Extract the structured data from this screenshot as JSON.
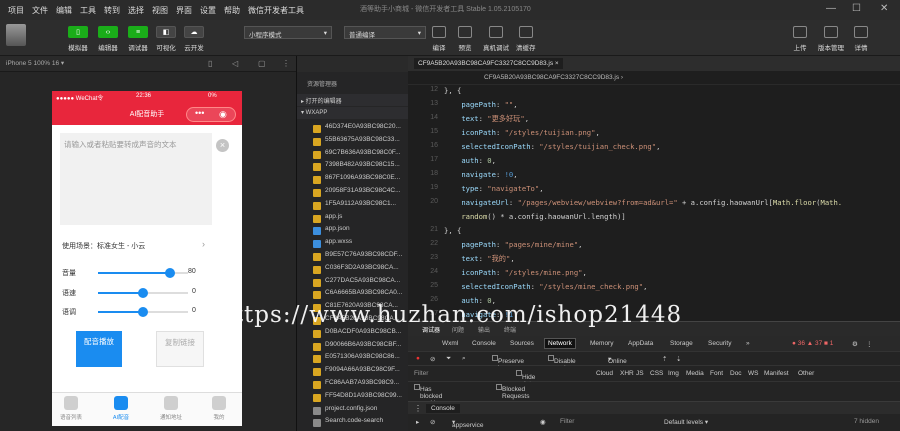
{
  "menubar": {
    "items": [
      "项目",
      "文件",
      "编辑",
      "工具",
      "转到",
      "选择",
      "视图",
      "界面",
      "设置",
      "帮助",
      "微信开发者工具"
    ],
    "title": "酒等助手小商城 - 微信开发者工具 Stable 1.05.2105170"
  },
  "toolbar": {
    "buttons": [
      {
        "icon": "code-icon",
        "label": "模拟器"
      },
      {
        "icon": "code-icon",
        "label": "编辑器"
      },
      {
        "icon": "debug-icon",
        "label": "调试器"
      },
      {
        "icon": "visual-icon",
        "label": "可视化"
      },
      {
        "icon": "cloud-icon",
        "label": "云开发"
      }
    ],
    "mode_select": "小程序模式",
    "compile_select": "普通编译",
    "actions": [
      "编译",
      "预览",
      "真机调试",
      "清缓存"
    ],
    "right": [
      "上传",
      "版本管理",
      "详情"
    ]
  },
  "simulator": {
    "device": "iPhone 5 100% 16 ▾",
    "status": {
      "carrier": "●●●●● WeChat令",
      "time": "22:36",
      "battery": "0%"
    },
    "nav_title": "AI配音助手",
    "placeholder": "请输入或者粘贴要转成声音的文本",
    "scene": "使用场景：标准女生 - 小云",
    "sliders": [
      {
        "label": "音量",
        "value": "80",
        "level": 0.8
      },
      {
        "label": "语速",
        "value": "0",
        "level": 0.5
      },
      {
        "label": "语调",
        "value": "0",
        "level": 0.5
      }
    ],
    "btn_compose": "配音播放",
    "btn_copy": "复制链接",
    "tabs": [
      "语音列表",
      "AI配音",
      "通知地址",
      "我的"
    ]
  },
  "explorer": {
    "title": "资源管理器",
    "section_open": "▸ 打开的编辑器",
    "section_app": "▾ WXAPP",
    "files": [
      {
        "name": "46D374E0A93BC98C20...",
        "t": "y"
      },
      {
        "name": "55B63675A93BC98C33...",
        "t": "y"
      },
      {
        "name": "69C7B636A93BC98C0F...",
        "t": "y"
      },
      {
        "name": "7398B482A93BC98C15...",
        "t": "y"
      },
      {
        "name": "867F1096A93BC98C0E...",
        "t": "y"
      },
      {
        "name": "20958F31A93BC98C4C...",
        "t": "y"
      },
      {
        "name": "1F5A9112A93BC98C1...",
        "t": "y"
      },
      {
        "name": "app.js",
        "t": "y"
      },
      {
        "name": "app.json",
        "t": "b"
      },
      {
        "name": "app.wxss",
        "t": "b"
      },
      {
        "name": "B9E57C76A93BC98CDF...",
        "t": "y"
      },
      {
        "name": "C036F3D2A93BC98CA...",
        "t": "y"
      },
      {
        "name": "C277DAC5A93BC98CA...",
        "t": "y"
      },
      {
        "name": "C6A6665BA93BC98CA0...",
        "t": "y"
      },
      {
        "name": "C81E7620A93BC98CA...",
        "t": "y"
      },
      {
        "name": "CF9A5B20A93BC98CA...",
        "t": "y"
      },
      {
        "name": "D0BACDF0A93BC98CB...",
        "t": "y"
      },
      {
        "name": "D90066B6A93BC98CBF...",
        "t": "y"
      },
      {
        "name": "E0571306A93BC98C86...",
        "t": "y"
      },
      {
        "name": "F9094A66A93BC98C9F...",
        "t": "y"
      },
      {
        "name": "FC86AAB7A93BC98C9...",
        "t": "y"
      },
      {
        "name": "FF54D8D1A93BC98C99...",
        "t": "y"
      },
      {
        "name": "project.config.json",
        "t": "g"
      },
      {
        "name": "Search.code-search",
        "t": "g"
      }
    ]
  },
  "editor": {
    "tab": "CF9A5B20A93BC98CA9FC3327C8CC9D83.js ×",
    "crumb": "CF9A5B20A93BC98CA9FC3327C8CC9D83.js ›",
    "line_numbers": [
      "12",
      "13",
      "14",
      "15",
      "16",
      "17",
      "18",
      "19",
      "20",
      "",
      "21",
      "22",
      "23",
      "24",
      "25",
      "26",
      "27"
    ]
  },
  "devtools": {
    "top_tabs": [
      "调试器",
      "问题",
      "输出",
      "终端"
    ],
    "tabs": [
      "Wxml",
      "Console",
      "Sources",
      "Network",
      "Memory",
      "AppData",
      "Storage",
      "Security",
      "»"
    ],
    "counts": "● 36 ▲ 37 ■ 1",
    "throttle": "Online",
    "preserve": "Preserve log",
    "disable_cache": "Disable cache",
    "filter": "Filter",
    "hide_data": "Hide data URLs",
    "types": [
      "Cloud",
      "XHR",
      "JS",
      "CSS",
      "Img",
      "Media",
      "Font",
      "Doc",
      "WS",
      "Manifest",
      "Other"
    ],
    "blocked_cookies": "Has blocked cookies",
    "blocked_requests": "Blocked Requests",
    "console_tab": "Console",
    "context": "appservice",
    "console_filter": "Filter",
    "levels": "Default levels ▾",
    "hidden": "7 hidden"
  },
  "watermark": "https://www.huzhan.com/ishop21448"
}
